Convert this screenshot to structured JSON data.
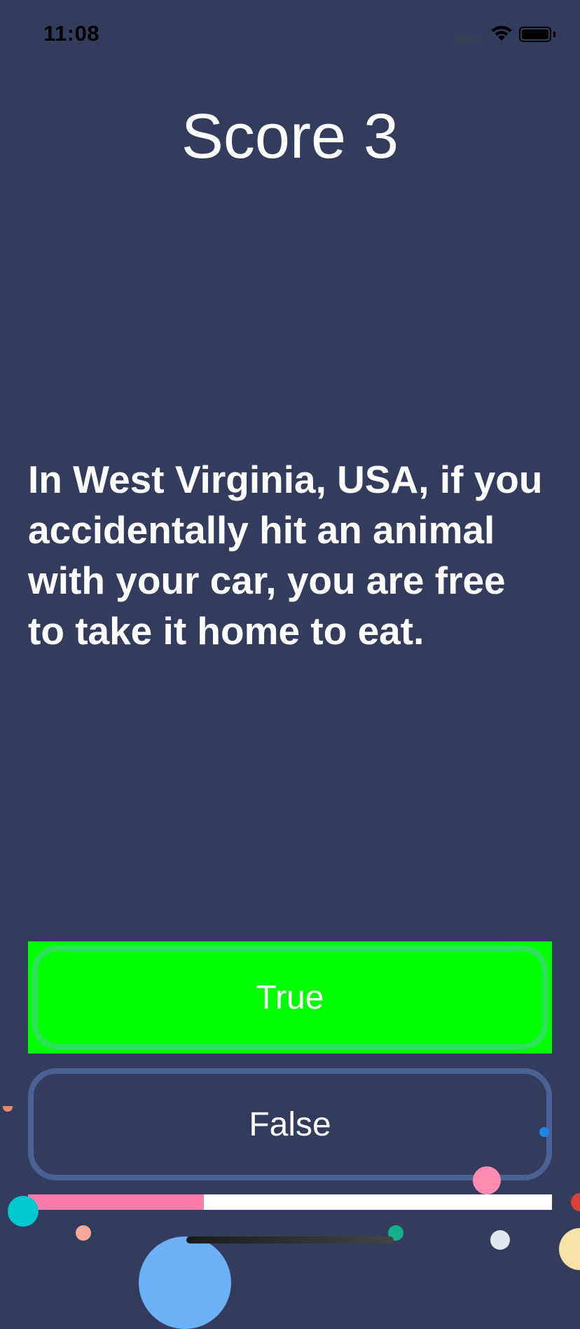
{
  "status_bar": {
    "time": "11:08"
  },
  "score": {
    "label": "Score 3"
  },
  "question": {
    "text": "In West Virginia, USA, if you accidentally hit an animal with your car, you are free to take it home to eat."
  },
  "answers": {
    "true_label": "True",
    "false_label": "False"
  },
  "progress": {
    "fraction": 0.335
  },
  "colors": {
    "background": "#333C5C",
    "true_button": "#00FF00",
    "true_border": "#2FE05A",
    "false_border": "#4A6296",
    "progress_fill": "#FF7BAA",
    "progress_track": "#FFFFFF"
  }
}
